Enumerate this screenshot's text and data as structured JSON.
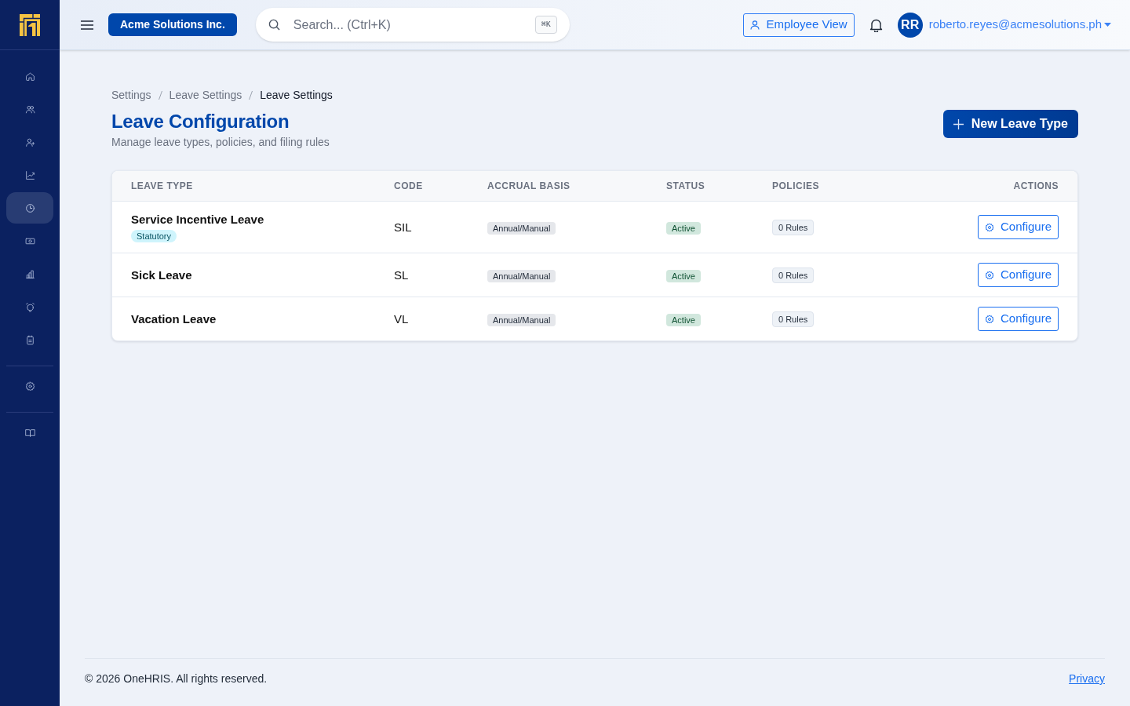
{
  "sidebar": {
    "groups": [
      {
        "items": [
          {
            "selected": false
          },
          {
            "selected": false
          },
          {
            "selected": false
          },
          {
            "selected": false
          },
          {
            "selected": true
          },
          {
            "selected": false
          },
          {
            "selected": false
          },
          {
            "selected": false
          },
          {
            "selected": false
          }
        ]
      },
      {
        "items": [
          {
            "selected": false
          }
        ]
      },
      {
        "items": [
          {
            "selected": false
          }
        ]
      }
    ]
  },
  "header": {
    "company": "Acme Solutions Inc.",
    "search": {
      "placeholder": "Search... (Ctrl+K)",
      "shortcut": "⌘K"
    },
    "employee_view_button": "Employee View",
    "user": {
      "initials": "RR",
      "email": "roberto.reyes@acmesolutions.ph"
    }
  },
  "breadcrumb": [
    {
      "label": "Settings",
      "current": false
    },
    {
      "label": "Leave Settings",
      "current": false
    },
    {
      "label": "Leave Settings",
      "current": true
    }
  ],
  "page": {
    "title": "Leave Configuration",
    "subtitle": "Manage leave types, policies, and filing rules",
    "new_button": "New Leave Type"
  },
  "table": {
    "columns": [
      "LEAVE TYPE",
      "CODE",
      "ACCRUAL BASIS",
      "STATUS",
      "POLICIES",
      "ACTIONS"
    ],
    "rows": [
      {
        "name": "Service Incentive Leave",
        "tags": [
          "Statutory"
        ],
        "code": "SIL",
        "accrual_basis": "Annual/Manual",
        "status": "Active",
        "policies": "0 Rules",
        "action": "Configure"
      },
      {
        "name": "Sick Leave",
        "code": "SL",
        "accrual_basis": "Annual/Manual",
        "status": "Active",
        "policies": "0 Rules",
        "action": "Configure"
      },
      {
        "name": "Vacation Leave",
        "code": "VL",
        "accrual_basis": "Annual/Manual",
        "status": "Active",
        "policies": "0 Rules",
        "action": "Configure"
      }
    ]
  },
  "footer": {
    "copyright": "© 2026 OneHRIS. All rights reserved.",
    "link": "Privacy"
  }
}
